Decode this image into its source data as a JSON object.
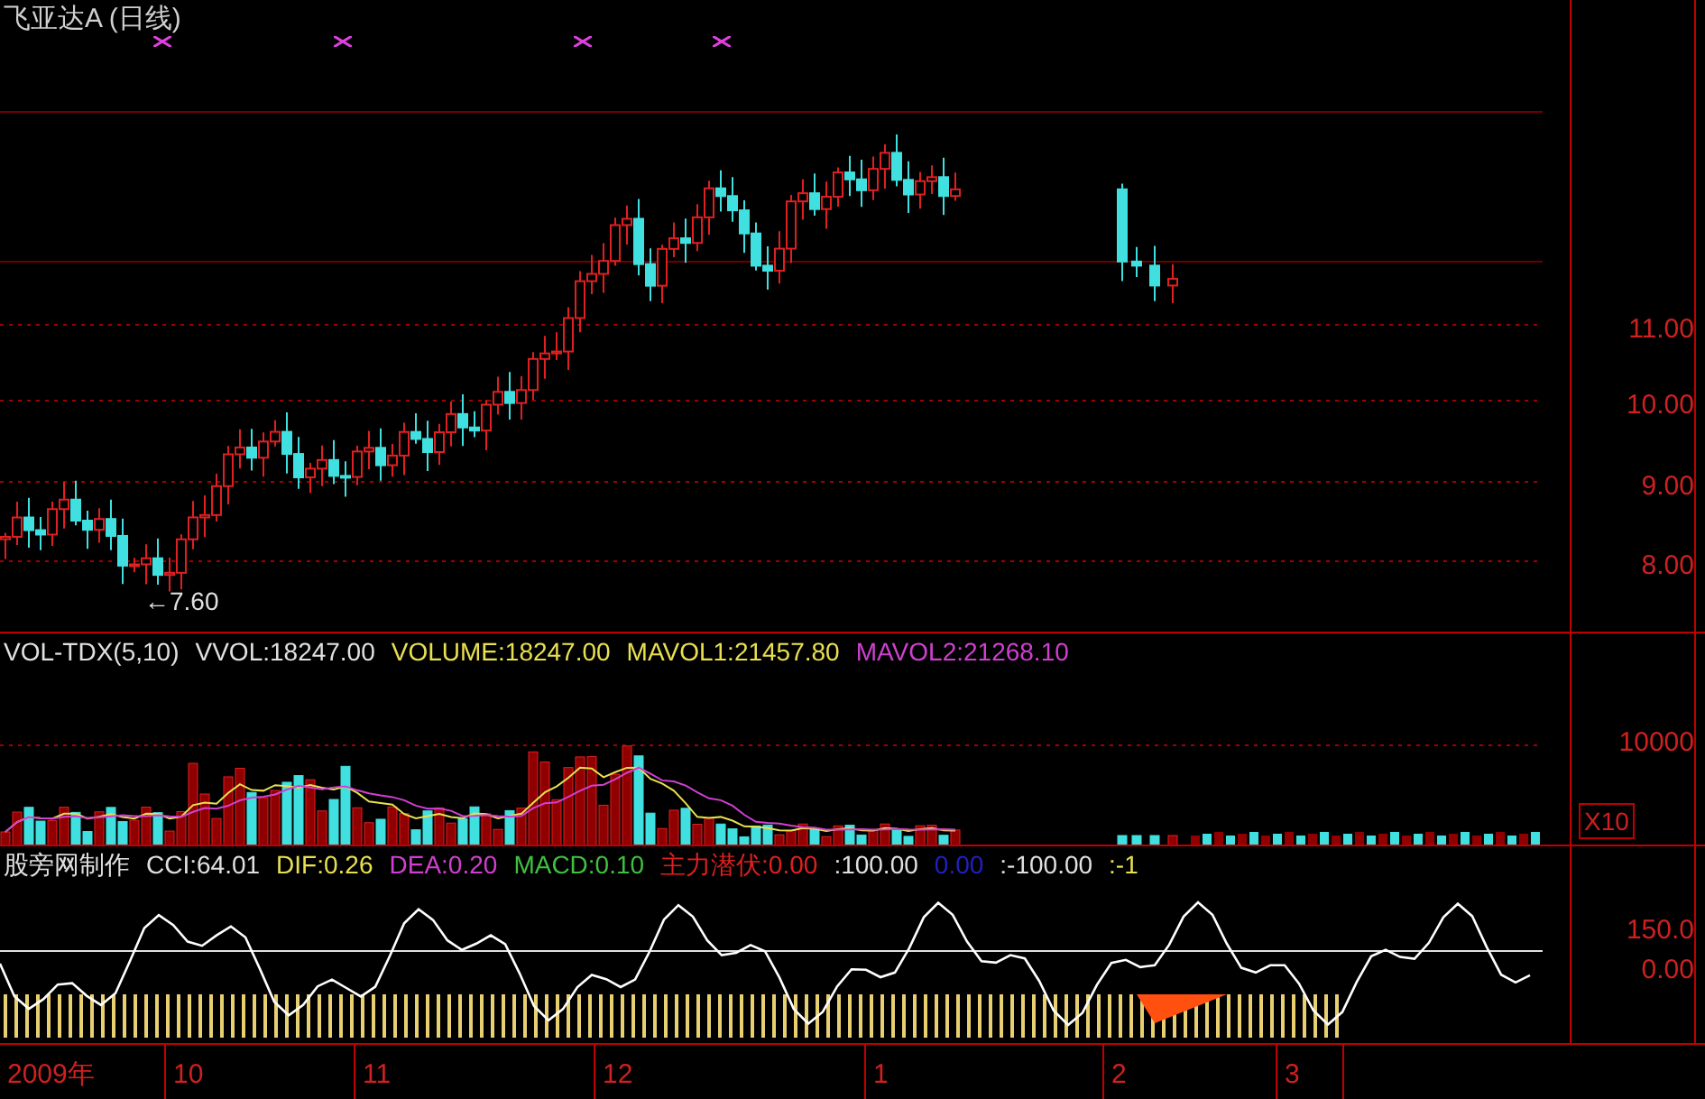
{
  "price_panel": {
    "title": "飞亚达A (日线)",
    "low_label": "←7.60",
    "axis_labels": [
      "11.00",
      "10.00",
      "9.00",
      "8.00"
    ]
  },
  "volume_panel": {
    "legend": [
      {
        "text": "VOL-TDX(5,10)",
        "color": "#e0e0e0"
      },
      {
        "text": "VVOL:18247.00",
        "color": "#e0e0e0"
      },
      {
        "text": "VOLUME:18247.00",
        "color": "#e8e050"
      },
      {
        "text": "MAVOL1:21457.80",
        "color": "#e8e050"
      },
      {
        "text": "MAVOL2:21268.10",
        "color": "#d040d0"
      }
    ],
    "axis_label": "10000",
    "scale_badge": "X10"
  },
  "indicator_panel": {
    "legend": [
      {
        "text": "股旁网制作",
        "color": "#e0e0e0"
      },
      {
        "text": "CCI:64.01",
        "color": "#e0e0e0"
      },
      {
        "text": "DIF:0.26",
        "color": "#e8e050"
      },
      {
        "text": "DEA:0.20",
        "color": "#d040d0"
      },
      {
        "text": "MACD:0.10",
        "color": "#40c040"
      },
      {
        "text": "主力潜伏:0.00",
        "color": "#e02020"
      },
      {
        "text": ":100.00",
        "color": "#e0e0e0"
      },
      {
        "text": "0.00",
        "color": "#2020c0"
      },
      {
        "text": ":-100.00",
        "color": "#e0e0e0"
      },
      {
        "text": ":-1",
        "color": "#e8e050"
      }
    ],
    "axis_labels": [
      "150.0",
      "0.00"
    ]
  },
  "date_axis": [
    "2009年",
    "10",
    "11",
    "12",
    "1",
    "2",
    "3"
  ]
}
